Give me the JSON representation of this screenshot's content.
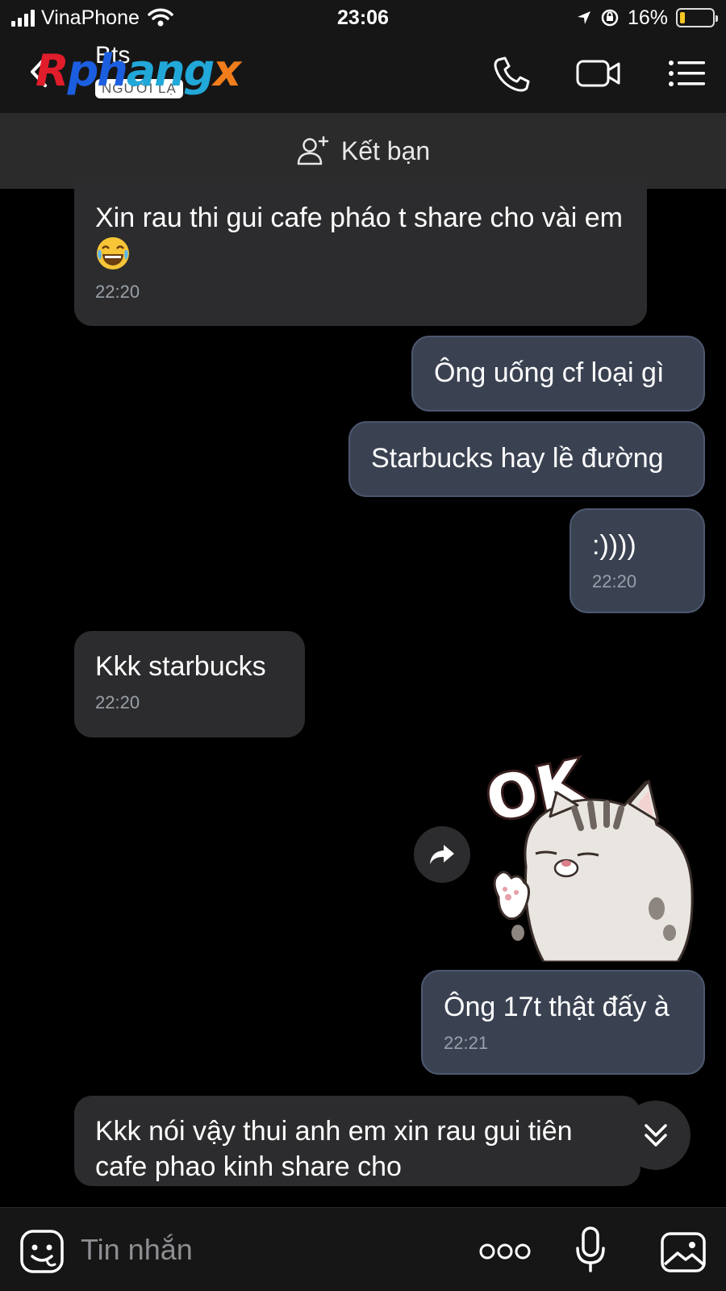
{
  "status_bar": {
    "carrier": "VinaPhone",
    "time": "23:06",
    "battery_text": "16%",
    "battery_level": 0.16,
    "battery_color": "#f3c623"
  },
  "header": {
    "contact_name": "Bts",
    "stranger_badge": "NGƯỜI LẠ",
    "watermark": {
      "part1": "R",
      "part2": "ph",
      "part3": "ang",
      "part4": "x"
    },
    "icons": [
      "back-icon",
      "phone-icon",
      "video-icon",
      "menu-icon"
    ]
  },
  "friend_bar": {
    "label": "Kết bạn",
    "icon": "add-friend-icon"
  },
  "messages": [
    {
      "direction": "incoming",
      "text": "Xin rau thi gui cafe pháo t share cho vài em",
      "emoji": "laughing-tears",
      "time": "22:20"
    },
    {
      "direction": "outgoing",
      "text": "Ông uống cf loại gì"
    },
    {
      "direction": "outgoing",
      "text": "Starbucks hay lề đường"
    },
    {
      "direction": "outgoing",
      "text": ":))))",
      "time": "22:20"
    },
    {
      "direction": "incoming",
      "text": "Kkk starbucks",
      "time": "22:20"
    },
    {
      "direction": "outgoing",
      "type": "sticker",
      "sticker_text": "OK",
      "sticker_desc": "cat"
    },
    {
      "direction": "outgoing",
      "text": "Ông 17t thật đấy à",
      "time": "22:21"
    },
    {
      "direction": "incoming",
      "text": "Kkk nói vậy thui anh em xin rau gui tiên cafe phao kinh share cho"
    }
  ],
  "composer": {
    "placeholder": "Tin nhắn",
    "icons": [
      "sticker-icon",
      "more-icon",
      "microphone-icon",
      "image-icon"
    ]
  },
  "colors": {
    "background": "#000000",
    "incoming_bubble": "#2c2c2e",
    "outgoing_bubble": "#3a4252",
    "timestamp": "#9aa0a8"
  }
}
